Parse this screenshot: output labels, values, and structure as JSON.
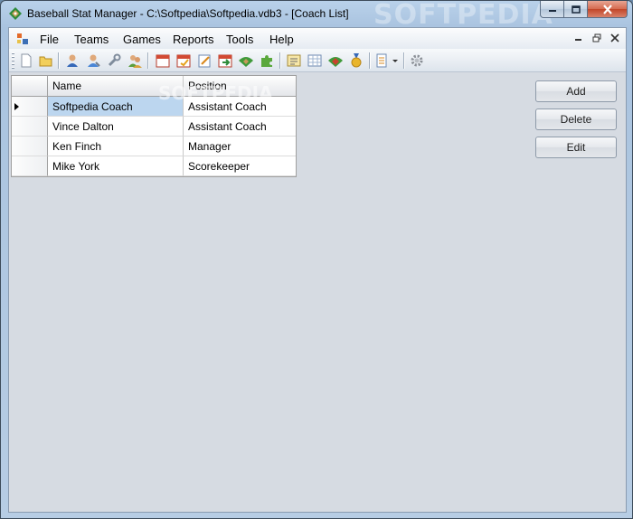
{
  "window": {
    "title": "Baseball Stat Manager - C:\\Softpedia\\Softpedia.vdb3 - [Coach List]",
    "watermark": "SOFTPEDIA"
  },
  "menu": {
    "items": [
      "File",
      "Teams",
      "Games",
      "Reports",
      "Tools",
      "Help"
    ]
  },
  "toolbar": {
    "icons": [
      "new-file-icon",
      "open-folder-icon",
      "coach-icon",
      "player-icon",
      "wrench-icon",
      "users-icon",
      "calendar-icon",
      "schedule-icon",
      "edit-note-icon",
      "game-import-icon",
      "field-icon",
      "puzzle-icon",
      "report-icon",
      "sheet-icon",
      "field-red-icon",
      "medal-icon",
      "list-dropdown-icon",
      "settings-gear-icon"
    ]
  },
  "grid": {
    "columns": [
      "Name",
      "Position"
    ],
    "rows": [
      {
        "name": "Softpedia Coach",
        "position": "Assistant Coach"
      },
      {
        "name": "Vince Dalton",
        "position": "Assistant Coach"
      },
      {
        "name": "Ken Finch",
        "position": "Manager"
      },
      {
        "name": "Mike York",
        "position": "Scorekeeper"
      }
    ],
    "selected_row": 0
  },
  "buttons": {
    "add": "Add",
    "delete": "Delete",
    "edit": "Edit"
  },
  "colors": {
    "selection": "#bcd6ef",
    "close_button": "#c24629"
  }
}
